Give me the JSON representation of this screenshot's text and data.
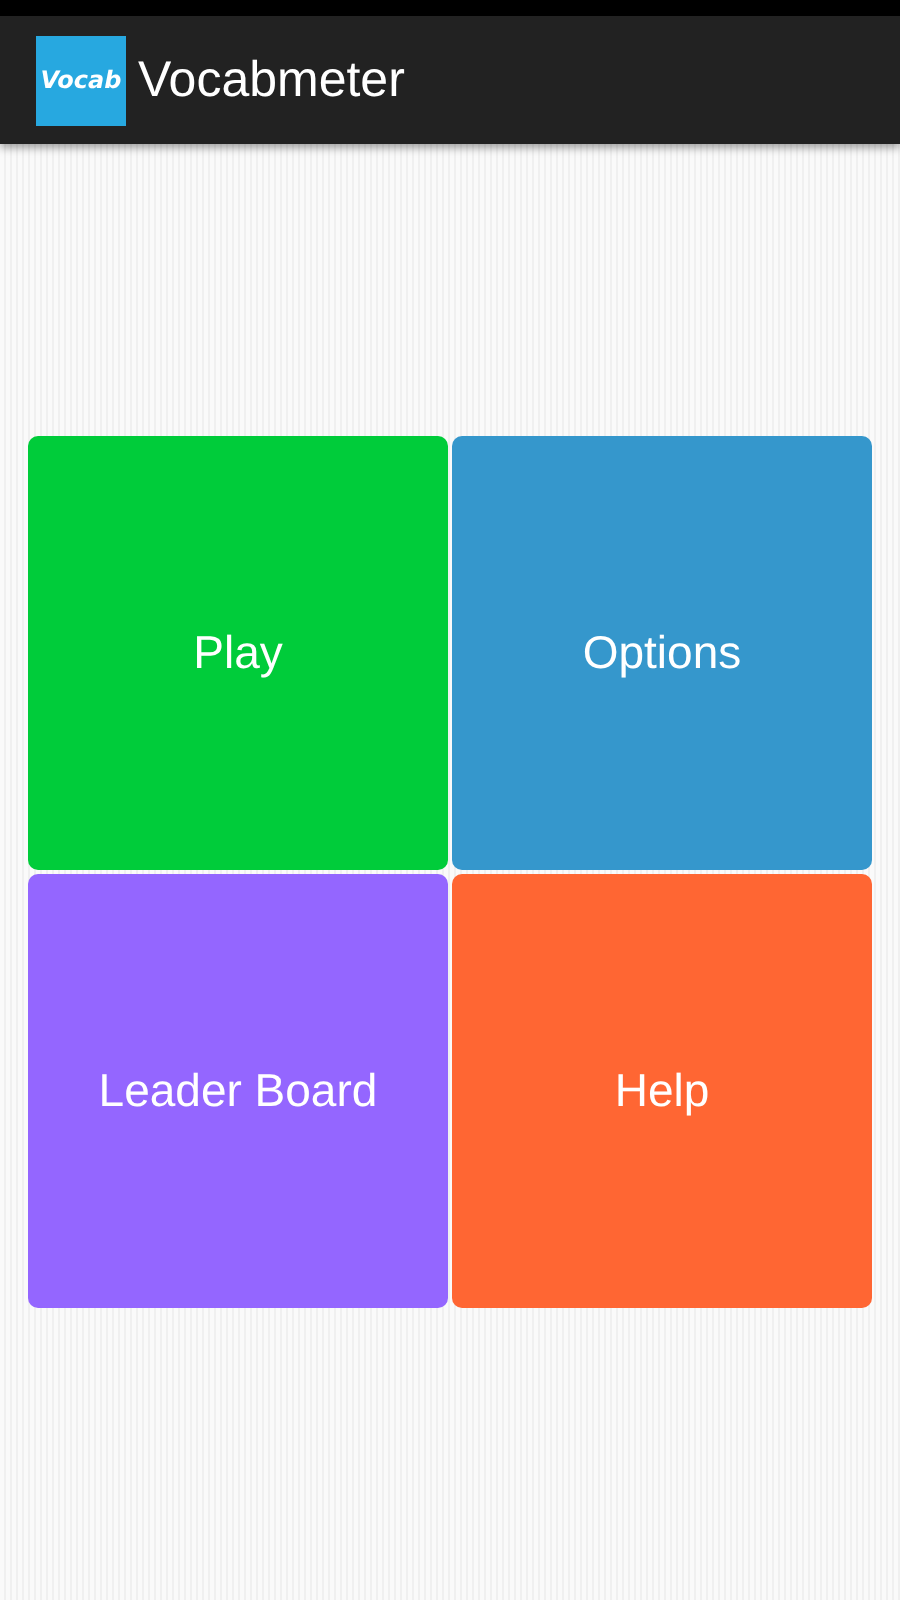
{
  "action_bar": {
    "logo_text": "Vocab",
    "title": "Vocabmeter"
  },
  "tiles": [
    {
      "label": "Play",
      "color": "#00cc3a"
    },
    {
      "label": "Options",
      "color": "#3597cc"
    },
    {
      "label": "Leader Board",
      "color": "#9466ff"
    },
    {
      "label": "Help",
      "color": "#ff6633"
    }
  ]
}
